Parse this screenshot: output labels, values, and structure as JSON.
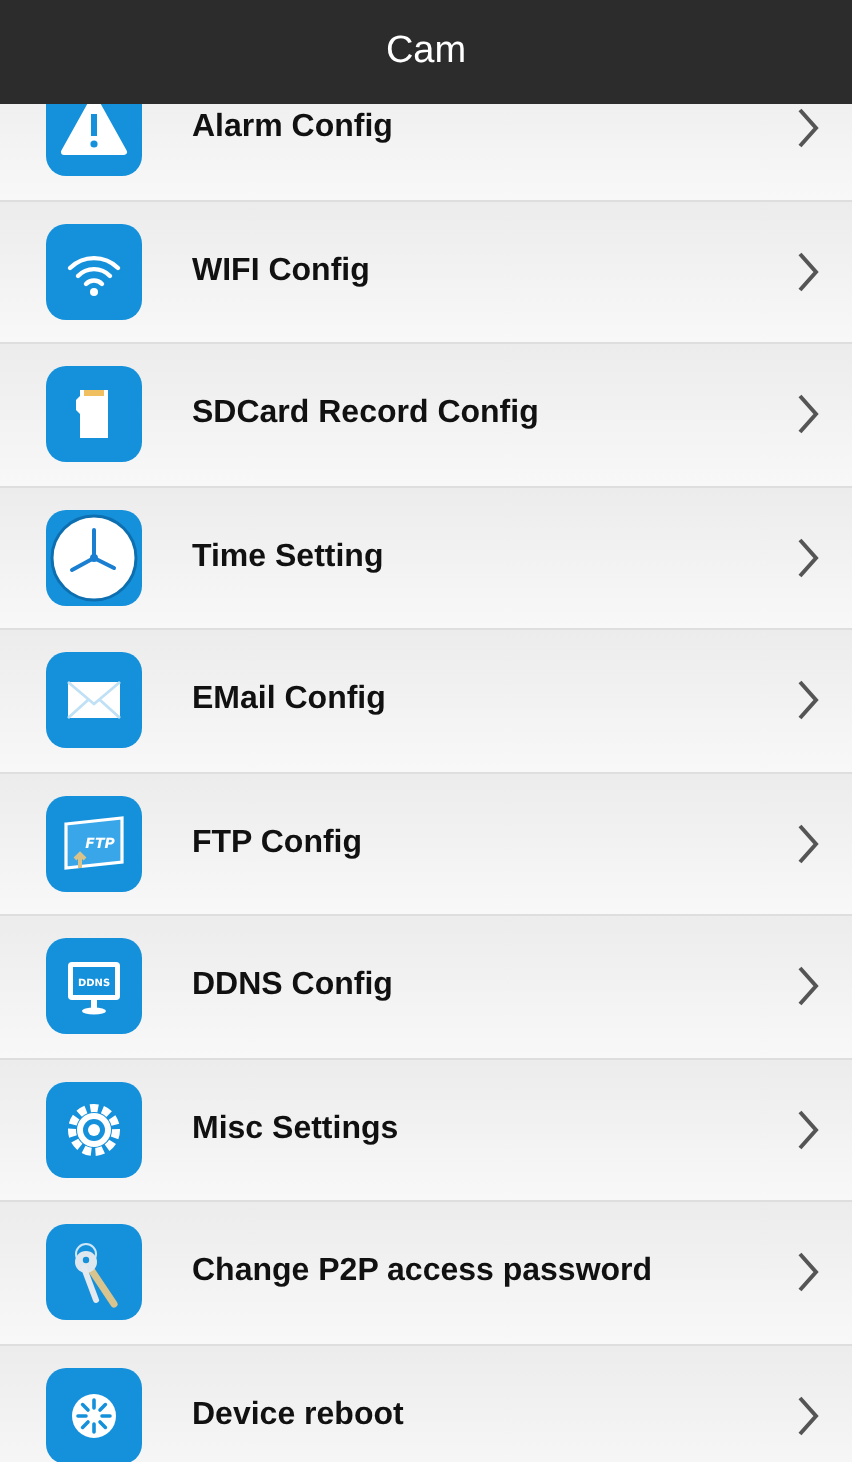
{
  "header": {
    "title": "Cam"
  },
  "items": [
    {
      "kind": "alarm",
      "label": "Alarm Config"
    },
    {
      "kind": "wifi",
      "label": "WIFI Config"
    },
    {
      "kind": "sdcard",
      "label": "SDCard Record Config"
    },
    {
      "kind": "clock",
      "label": "Time Setting"
    },
    {
      "kind": "email",
      "label": "EMail Config"
    },
    {
      "kind": "ftp",
      "label": "FTP Config",
      "icon_text": "FTP"
    },
    {
      "kind": "ddns",
      "label": "DDNS Config",
      "icon_text": "DDNS"
    },
    {
      "kind": "gear",
      "label": "Misc Settings"
    },
    {
      "kind": "key",
      "label": "Change P2P access password"
    },
    {
      "kind": "reboot",
      "label": "Device reboot"
    }
  ]
}
